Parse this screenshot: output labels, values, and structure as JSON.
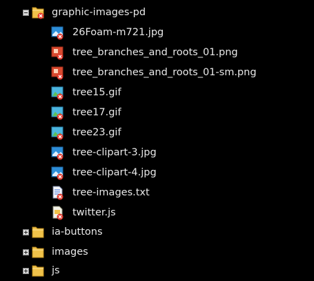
{
  "tree": {
    "root_folder": {
      "label": "graphic-images-pd",
      "icon": "folder-icon",
      "expanded": true,
      "children": [
        {
          "label": "26Foam-m721.jpg",
          "icon": "jpg-file-icon"
        },
        {
          "label": "tree_branches_and_roots_01.png",
          "icon": "png-file-icon"
        },
        {
          "label": "tree_branches_and_roots_01-sm.png",
          "icon": "png-file-icon"
        },
        {
          "label": "tree15.gif",
          "icon": "gif-file-icon"
        },
        {
          "label": "tree17.gif",
          "icon": "gif-file-icon"
        },
        {
          "label": "tree23.gif",
          "icon": "gif-file-icon"
        },
        {
          "label": "tree-clipart-3.jpg",
          "icon": "jpg-file-icon"
        },
        {
          "label": "tree-clipart-4.jpg",
          "icon": "jpg-file-icon"
        },
        {
          "label": "tree-images.txt",
          "icon": "txt-file-icon"
        },
        {
          "label": "twitter.js",
          "icon": "js-file-icon"
        }
      ]
    },
    "sibling_folders": [
      {
        "label": "ia-buttons",
        "icon": "folder-icon",
        "expanded": false
      },
      {
        "label": "images",
        "icon": "folder-icon",
        "expanded": false
      },
      {
        "label": "js",
        "icon": "folder-icon",
        "expanded": false
      }
    ]
  },
  "colors": {
    "background": "#000000",
    "text": "#e8e8e8",
    "folder": "#f0c24a",
    "error_badge": "#e23b2e"
  }
}
